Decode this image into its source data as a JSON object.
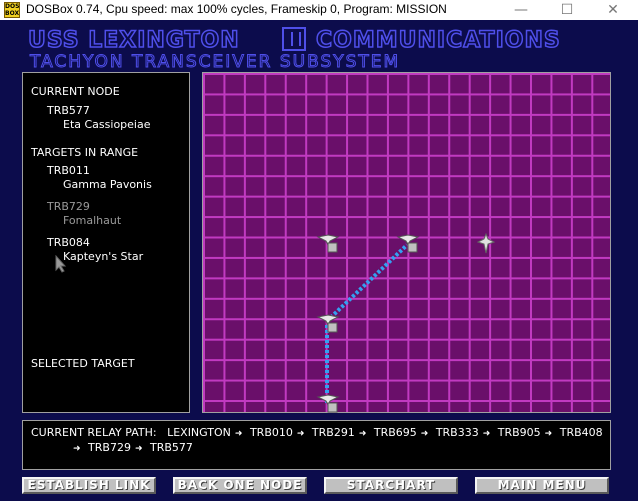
{
  "window": {
    "app_icon_text": "DOS BOX",
    "title": "DOSBox 0.74, Cpu speed: max 100% cycles, Frameskip  0, Program:  MISSION",
    "min_glyph": "—",
    "max_glyph": "☐",
    "close_glyph": "✕"
  },
  "header": {
    "left": "USS LEXINGTON",
    "right": "COMMUNICATIONS",
    "subtitle": "TACHYON TRANSCEIVER SUBSYSTEM"
  },
  "info": {
    "current_node_label": "CURRENT NODE",
    "current_node": {
      "id": "TRB577",
      "name": "Eta Cassiopeiae"
    },
    "targets_label": "TARGETS IN RANGE",
    "targets": [
      {
        "id": "TRB011",
        "name": "Gamma Pavonis"
      },
      {
        "id": "TRB729",
        "name": "Fomalhaut"
      },
      {
        "id": "TRB084",
        "name": "Kapteyn's Star"
      }
    ],
    "selected_label": "SELECTED TARGET"
  },
  "relay": {
    "label": "CURRENT RELAY PATH:",
    "line1": [
      "LEXINGTON",
      "TRB010",
      "TRB291",
      "TRB695",
      "TRB333",
      "TRB905",
      "TRB408"
    ],
    "line2": [
      "TRB729",
      "TRB577"
    ],
    "arrow": "➜"
  },
  "buttons": {
    "establish": "ESTABLISH LINK",
    "back": "BACK ONE NODE",
    "starchart": "STARCHART",
    "mainmenu": "MAIN MENU"
  },
  "colors": {
    "background": "#0c0c4c",
    "header_outline": "#4f4fea",
    "grid_fill": "#6a0f6a",
    "grid_lines": "#c13ac1",
    "link_line": "#34a0f0"
  }
}
